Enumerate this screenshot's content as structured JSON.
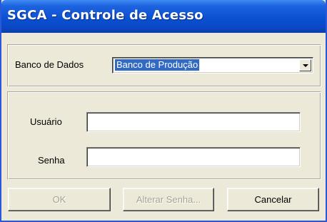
{
  "window": {
    "title": "SGCA - Controle de Acesso"
  },
  "database": {
    "label": "Banco de Dados",
    "selected": "Banco de Produção"
  },
  "login": {
    "user_label": "Usuário",
    "user_value": "",
    "password_label": "Senha",
    "password_value": ""
  },
  "buttons": {
    "ok_label": "OK",
    "ok_enabled": false,
    "change_password_label": "Alterar Senha...",
    "change_password_enabled": false,
    "cancel_label": "Cancelar",
    "cancel_enabled": true
  }
}
